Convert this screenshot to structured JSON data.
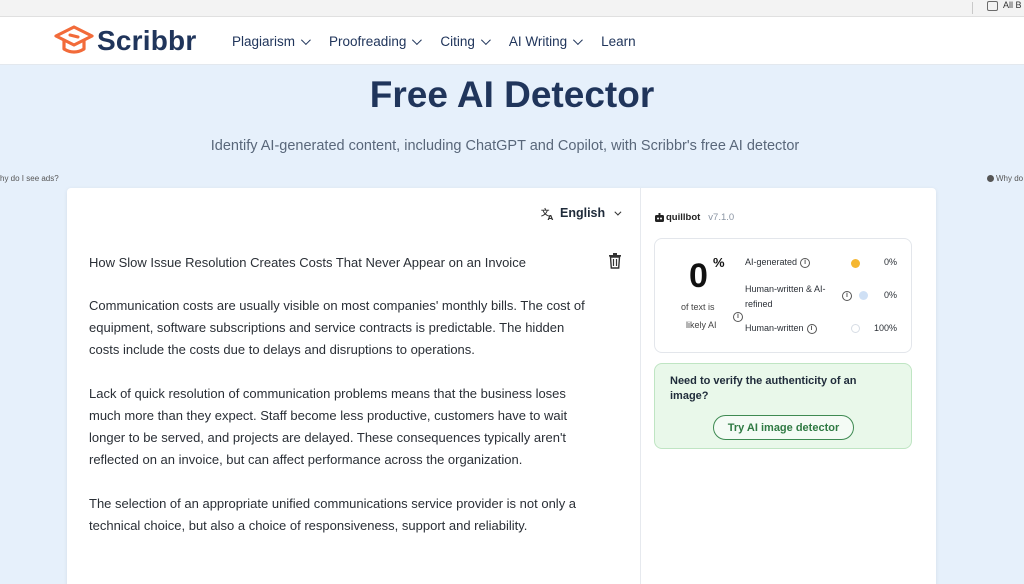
{
  "browser": {
    "bookmark_label": "All B"
  },
  "header": {
    "logo_text": "Scribbr",
    "nav": [
      {
        "label": "Plagiarism",
        "dropdown": true
      },
      {
        "label": "Proofreading",
        "dropdown": true
      },
      {
        "label": "Citing",
        "dropdown": true
      },
      {
        "label": "AI Writing",
        "dropdown": true
      },
      {
        "label": "Learn",
        "dropdown": false
      }
    ]
  },
  "hero": {
    "title": "Free AI Detector",
    "subtitle": "Identify AI-generated content, including ChatGPT and Copilot, with Scribbr's free AI detector"
  },
  "ads": {
    "left": "hy do I see ads?",
    "right": "Why do"
  },
  "editor": {
    "language": "English",
    "doc_title": "How Slow Issue Resolution Creates Costs That Never Appear on an Invoice",
    "paragraphs": [
      "Communication costs are usually visible on most companies' monthly bills. The cost of equipment, software subscriptions and service contracts is predictable. The hidden costs include the costs due to delays and disruptions to operations.",
      "Lack of quick resolution of communication problems means that the business loses much more than they expect. Staff become less productive, customers have to wait longer to be served, and projects are delayed. These consequences typically aren't reflected on an invoice, but can affect performance across the organization.",
      "The selection of an appropriate unified communications service provider is not only a technical choice, but also a choice of responsiveness, support and reliability."
    ]
  },
  "results": {
    "brand": "quillbot",
    "version": "v7.1.0",
    "score": "0",
    "score_unit": "%",
    "caption_line1": "of text is",
    "caption_line2": "likely AI",
    "rows": [
      {
        "label_line1": "AI-generated",
        "label_line2": "",
        "value": "0%",
        "color": "#f5b731"
      },
      {
        "label_line1": "Human-written & AI-",
        "label_line2": "refined",
        "value": "0%",
        "color": "#cfe0f5"
      },
      {
        "label_line1": "Human-written",
        "label_line2": "",
        "value": "100%",
        "color": "#ffffff"
      }
    ]
  },
  "image_check": {
    "question": "Need to verify the authenticity of an image?",
    "button_label": "Try AI image detector"
  },
  "colors": {
    "brand_orange": "#f26b3a",
    "brand_navy": "#20355b",
    "page_bg": "#e6f0fb",
    "success_green": "#2f7a43"
  }
}
